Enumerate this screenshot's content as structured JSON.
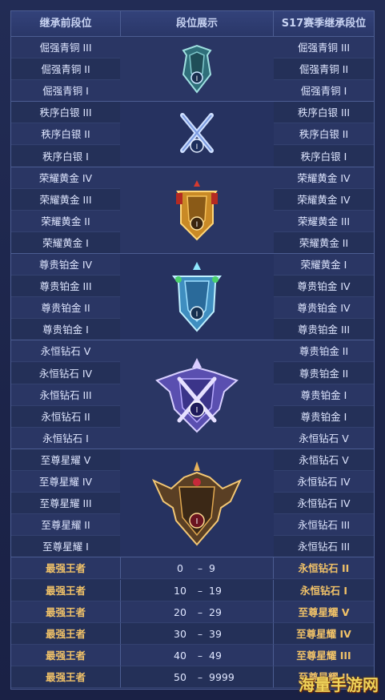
{
  "table": {
    "headers": {
      "left": "继承前段位",
      "mid": "段位展示",
      "right": "S17赛季继承段位"
    },
    "groups": [
      {
        "badge": "bronze-badge-icon",
        "rows": [
          {
            "before": "倔强青铜 III",
            "after": "倔强青铜 III"
          },
          {
            "before": "倔强青铜 II",
            "after": "倔强青铜 II"
          },
          {
            "before": "倔强青铜 I",
            "after": "倔强青铜 I"
          }
        ]
      },
      {
        "badge": "silver-badge-icon",
        "rows": [
          {
            "before": "秩序白银 III",
            "after": "秩序白银 III"
          },
          {
            "before": "秩序白银 II",
            "after": "秩序白银 II"
          },
          {
            "before": "秩序白银 I",
            "after": "秩序白银 I"
          }
        ]
      },
      {
        "badge": "gold-badge-icon",
        "rows": [
          {
            "before": "荣耀黄金 IV",
            "after": "荣耀黄金 IV"
          },
          {
            "before": "荣耀黄金 III",
            "after": "荣耀黄金 IV"
          },
          {
            "before": "荣耀黄金 II",
            "after": "荣耀黄金 III"
          },
          {
            "before": "荣耀黄金 I",
            "after": "荣耀黄金 II"
          }
        ]
      },
      {
        "badge": "platinum-badge-icon",
        "rows": [
          {
            "before": "尊贵铂金 IV",
            "after": "荣耀黄金 I"
          },
          {
            "before": "尊贵铂金 III",
            "after": "尊贵铂金 IV"
          },
          {
            "before": "尊贵铂金 II",
            "after": "尊贵铂金 IV"
          },
          {
            "before": "尊贵铂金 I",
            "after": "尊贵铂金 III"
          }
        ]
      },
      {
        "badge": "diamond-badge-icon",
        "rows": [
          {
            "before": "永恒钻石 V",
            "after": "尊贵铂金 II"
          },
          {
            "before": "永恒钻石 IV",
            "after": "尊贵铂金 II"
          },
          {
            "before": "永恒钻石 III",
            "after": "尊贵铂金 I"
          },
          {
            "before": "永恒钻石 II",
            "after": "尊贵铂金 I"
          },
          {
            "before": "永恒钻石 I",
            "after": "永恒钻石 V"
          }
        ]
      },
      {
        "badge": "starlight-badge-icon",
        "rows": [
          {
            "before": "至尊星耀 V",
            "after": "永恒钻石 V"
          },
          {
            "before": "至尊星耀 IV",
            "after": "永恒钻石 IV"
          },
          {
            "before": "至尊星耀 III",
            "after": "永恒钻石 IV"
          },
          {
            "before": "至尊星耀 II",
            "after": "永恒钻石 III"
          },
          {
            "before": "至尊星耀 I",
            "after": "永恒钻石 III"
          }
        ]
      }
    ],
    "king_rows": [
      {
        "before": "最强王者",
        "from": "0",
        "dash": "–",
        "to": "9",
        "after": "永恒钻石 II"
      },
      {
        "before": "最强王者",
        "from": "10",
        "dash": "–",
        "to": "19",
        "after": "永恒钻石 I"
      },
      {
        "before": "最强王者",
        "from": "20",
        "dash": "–",
        "to": "29",
        "after": "至尊星耀 V"
      },
      {
        "before": "最强王者",
        "from": "30",
        "dash": "–",
        "to": "39",
        "after": "至尊星耀 IV"
      },
      {
        "before": "最强王者",
        "from": "40",
        "dash": "–",
        "to": "49",
        "after": "至尊星耀 III"
      },
      {
        "before": "最强王者",
        "from": "50",
        "dash": "–",
        "to": "9999",
        "after": "至尊星耀 II"
      }
    ]
  },
  "watermark": "海量手游网",
  "colors": {
    "text": "#dfe6ff",
    "gold_text": "#f1c268",
    "border": "#4c5d92",
    "bg": "#26315d"
  }
}
